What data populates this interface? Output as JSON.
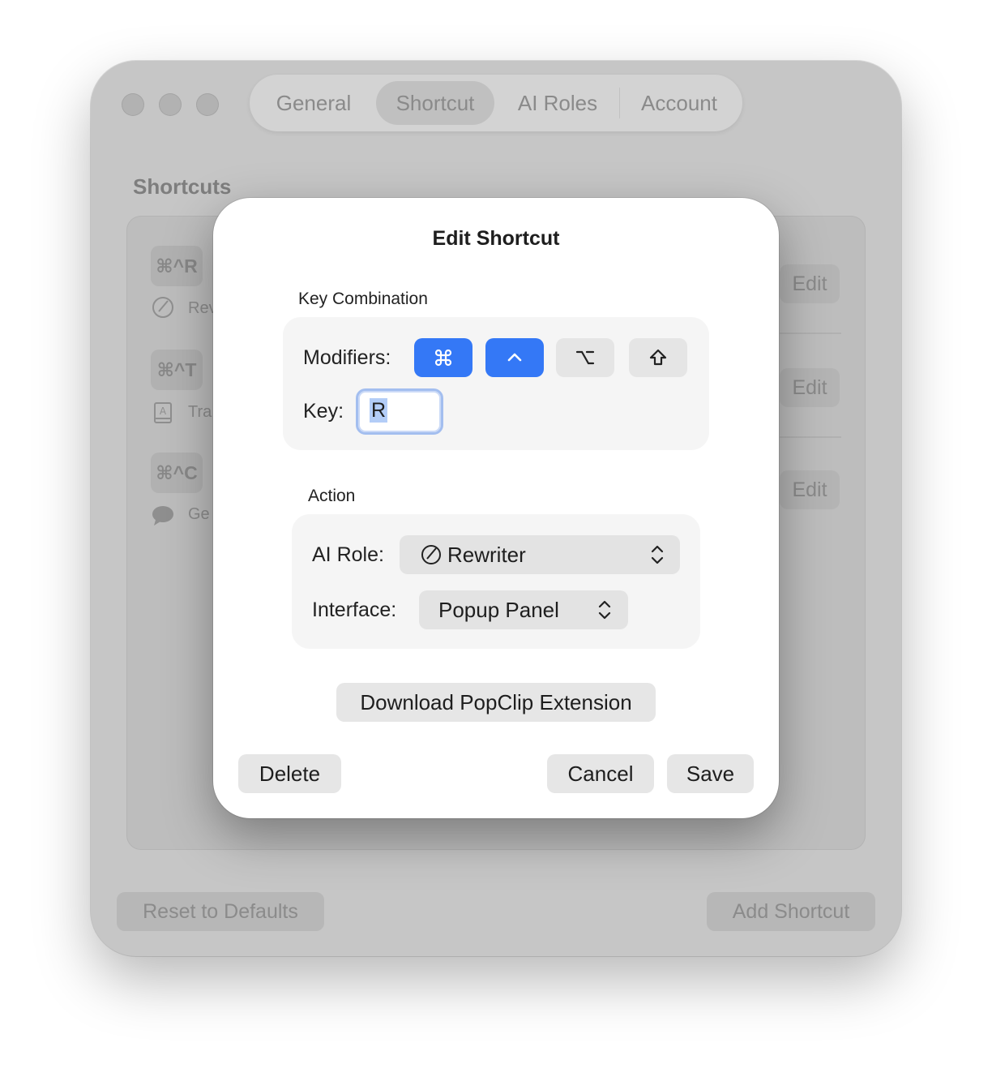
{
  "settings_window": {
    "tabs": [
      {
        "label": "General"
      },
      {
        "label": "Shortcut"
      },
      {
        "label": "AI Roles"
      },
      {
        "label": "Account"
      }
    ],
    "section_title": "Shortcuts",
    "shortcut_rows": [
      {
        "keys": "⌘^R",
        "label": "Rev",
        "icon": "rewriter-icon",
        "edit_label": "Edit"
      },
      {
        "keys": "⌘^T",
        "label": "Tra",
        "icon": "translator-book-icon",
        "edit_label": "Edit"
      },
      {
        "keys": "⌘^C",
        "label": "Ge",
        "icon": "chat-bubble-icon",
        "edit_label": "Edit"
      }
    ],
    "reset_label": "Reset to Defaults",
    "add_label": "Add Shortcut"
  },
  "dialog": {
    "title": "Edit Shortcut",
    "key_combination_label": "Key Combination",
    "modifiers_label": "Modifiers:",
    "modifiers": [
      {
        "name": "command",
        "symbol": "⌘",
        "selected": true
      },
      {
        "name": "control",
        "symbol": "^",
        "selected": true
      },
      {
        "name": "option",
        "symbol": "⌥",
        "selected": false
      },
      {
        "name": "shift",
        "symbol": "⇧",
        "selected": false
      }
    ],
    "key_label": "Key:",
    "key_value": "R",
    "action_label": "Action",
    "ai_role_label": "AI Role:",
    "ai_role_value": "Rewriter",
    "interface_label": "Interface:",
    "interface_value": "Popup Panel",
    "download_label": "Download PopClip Extension",
    "delete_label": "Delete",
    "cancel_label": "Cancel",
    "save_label": "Save"
  },
  "colors": {
    "accent": "#3478f6",
    "dimmed_window": "#c6c6c6",
    "dialog_bg": "#ffffff"
  }
}
